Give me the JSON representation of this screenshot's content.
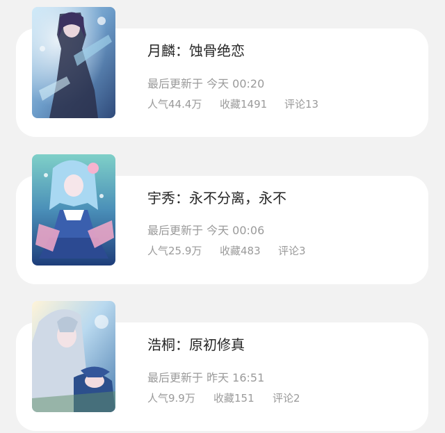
{
  "comics": [
    {
      "title": "月麟：蚀骨绝恋",
      "updated": "最后更新于 今天 00:20",
      "popularity": "人气44.4万",
      "favorites": "收藏1491",
      "comments": "评论13"
    },
    {
      "title": "宇秀：永不分离，永不",
      "updated": "最后更新于 今天 00:06",
      "popularity": "人气25.9万",
      "favorites": "收藏483",
      "comments": "评论3"
    },
    {
      "title": "浩桐：原初修真",
      "updated": "最后更新于 昨天 16:51",
      "popularity": "人气9.9万",
      "favorites": "收藏151",
      "comments": "评论2"
    }
  ]
}
